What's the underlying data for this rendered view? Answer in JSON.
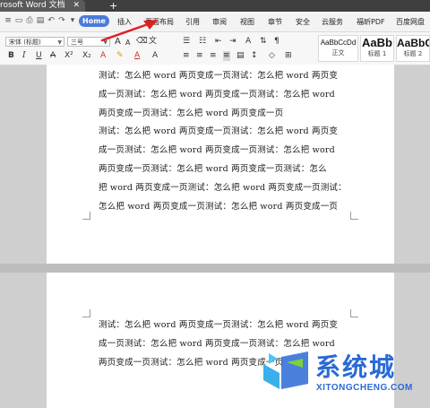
{
  "titlebar": {
    "doc_title": "rosoft Word 文档"
  },
  "menubar": {
    "home_label": "Home",
    "items": [
      "插入",
      "页面布局",
      "引用",
      "审阅",
      "视图",
      "章节",
      "安全",
      "云服务",
      "福昕PDF",
      "百度网盘"
    ]
  },
  "ribbon": {
    "font_name": "宋体 (标题)",
    "font_size": "三号",
    "styles": [
      {
        "sample": "AaBbCcDd",
        "caption": "正文"
      },
      {
        "sample": "AaBb",
        "caption": "标题 1"
      },
      {
        "sample": "AaBbC",
        "caption": "标题 2"
      }
    ]
  },
  "page1": {
    "lines": [
      "测试：怎么把 word 两页变成一页测试：怎么把 word 两页变",
      "成一页测试：怎么把 word 两页变成一页测试：怎么把 word",
      "两页变成一页测试：怎么把 word 两页变成一页",
      "测试：怎么把 word 两页变成一页测试：怎么把 word 两页变",
      "成一页测试：怎么把 word 两页变成一页测试：怎么把 word",
      "两页变成一页测试：怎么把 word 两页变成一页测试：怎么",
      "把 word 两页变成一页测试：怎么把 word 两页变成一页测试：",
      "怎么把 word 两页变成一页测试：怎么把 word 两页变成一页"
    ]
  },
  "page2": {
    "lines": [
      "测试：怎么把 word 两页变成一页测试：怎么把 word 两页变",
      "成一页测试：怎么把 word 两页变成一页测试：怎么把 word",
      "两页变成一页测试：怎么把 word 两页变成一页"
    ]
  },
  "watermark": {
    "name": "系统城",
    "url": "XITONGCHENG.COM"
  },
  "colors": {
    "accent": "#4b7bd8",
    "watermark": "#2a6ad6",
    "arrow": "#e02020"
  }
}
